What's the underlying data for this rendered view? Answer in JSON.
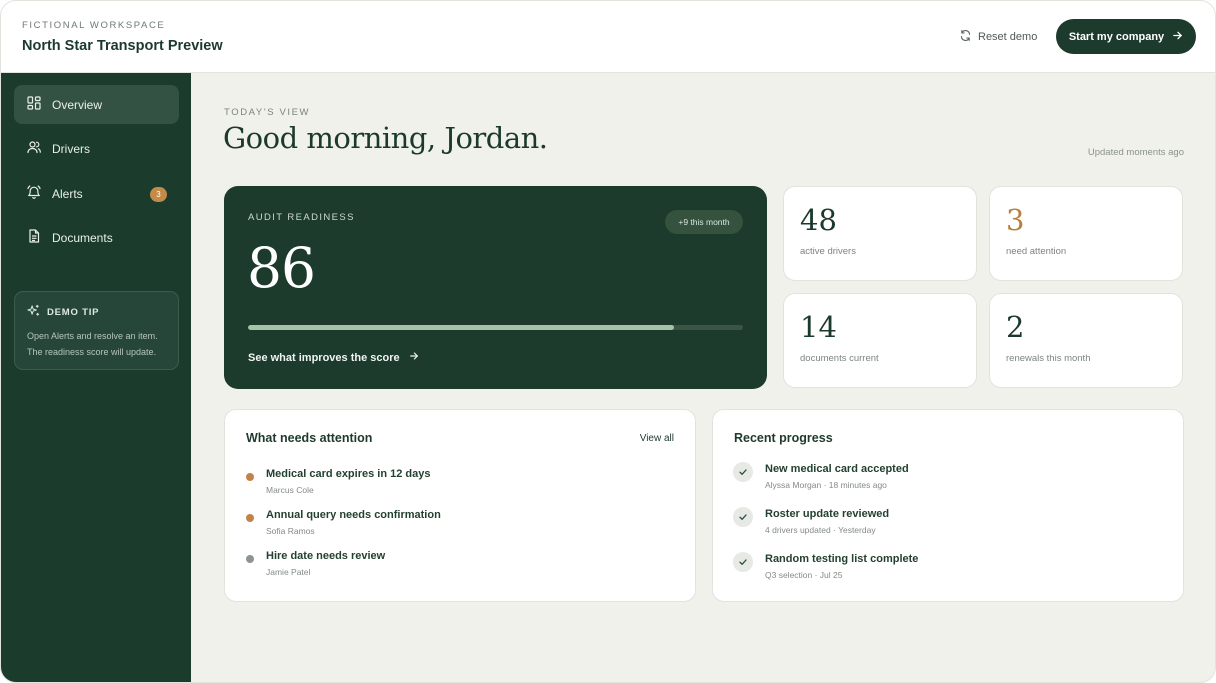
{
  "header": {
    "eyebrow": "FICTIONAL WORKSPACE",
    "title": "North Star Transport Preview",
    "reset_label": "Reset demo",
    "start_label": "Start my company"
  },
  "sidebar": {
    "items": [
      {
        "label": "Overview",
        "icon": "grid-icon",
        "active": true
      },
      {
        "label": "Drivers",
        "icon": "users-icon"
      },
      {
        "label": "Alerts",
        "icon": "bell-icon",
        "badge": "3"
      },
      {
        "label": "Documents",
        "icon": "document-icon"
      }
    ],
    "tip": {
      "title": "DEMO TIP",
      "text": "Open Alerts and resolve an item. The readiness score will update."
    }
  },
  "main": {
    "eyebrow": "TODAY'S VIEW",
    "greeting": "Good morning, Jordan.",
    "updated": "Updated moments ago",
    "audit": {
      "label": "AUDIT READINESS",
      "change": "+9 this month",
      "score": "86",
      "progress_percent": 86,
      "link": "See what improves the score"
    },
    "stats": [
      {
        "value": "48",
        "label": "active drivers"
      },
      {
        "value": "3",
        "label": "need attention",
        "warn": true
      },
      {
        "value": "14",
        "label": "documents current"
      },
      {
        "value": "2",
        "label": "renewals this month"
      }
    ],
    "attention": {
      "title": "What needs attention",
      "link": "View all",
      "items": [
        {
          "title": "Medical card expires in 12 days",
          "sub": "Marcus Cole",
          "color": "#c0834a"
        },
        {
          "title": "Annual query needs confirmation",
          "sub": "Sofia Ramos",
          "color": "#c0834a"
        },
        {
          "title": "Hire date needs review",
          "sub": "Jamie Patel",
          "color": "#8d958f"
        }
      ]
    },
    "progress": {
      "title": "Recent progress",
      "items": [
        {
          "title": "New medical card accepted",
          "sub": "Alyssa Morgan · 18 minutes ago"
        },
        {
          "title": "Roster update reviewed",
          "sub": "4 drivers updated · Yesterday"
        },
        {
          "title": "Random testing list complete",
          "sub": "Q3 selection · Jul 25"
        }
      ]
    }
  },
  "colors": {
    "brand": "#1c3b2c",
    "accent": "#c0834a",
    "progress_fill": "#a3c4a6"
  }
}
